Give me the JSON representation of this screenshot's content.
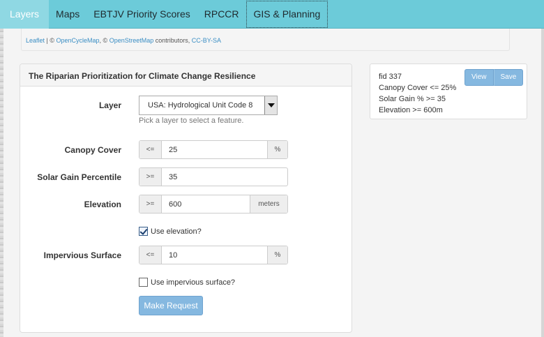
{
  "nav": {
    "items": [
      {
        "label": "Layers"
      },
      {
        "label": "Maps"
      },
      {
        "label": "EBTJV Priority Scores"
      },
      {
        "label": "RPCCR"
      },
      {
        "label": "GIS & Planning"
      }
    ]
  },
  "attribution": {
    "leaflet": "Leaflet",
    "sep1": " | © ",
    "opencyclemap": "OpenCycleMap",
    "sep2": ", © ",
    "openstreetmap": "OpenStreetMap",
    "contributors": " contributors, ",
    "license": "CC-BY-SA"
  },
  "panel": {
    "title": "The Riparian Prioritization for Climate Change Resilience",
    "layer": {
      "label": "Layer",
      "value": "USA: Hydrological Unit Code 8",
      "help": "Pick a layer to select a feature."
    },
    "canopy": {
      "label": "Canopy Cover",
      "operator": "<=",
      "value": "25",
      "unit": "%"
    },
    "solar": {
      "label": "Solar Gain Percentile",
      "operator": ">=",
      "value": "35"
    },
    "elevation": {
      "label": "Elevation",
      "operator": ">=",
      "value": "600",
      "unit": "meters"
    },
    "use_elevation": {
      "label": "Use elevation?",
      "checked": true
    },
    "impervious": {
      "label": "Impervious Surface",
      "operator": "<=",
      "value": "10",
      "unit": "%"
    },
    "use_impervious": {
      "label": "Use impervious surface?",
      "checked": false
    },
    "submit_label": "Make Request"
  },
  "summary": {
    "lines": [
      "fid 337",
      "Canopy Cover <= 25%",
      "Solar Gain % >= 35",
      "Elevation >= 600m"
    ],
    "view_label": "View",
    "save_label": "Save"
  },
  "colors": {
    "navbar": "#6ccbd9",
    "nav_active": "#8fd8e3",
    "button_primary": "#85b8e0",
    "link": "#3a8ec4"
  }
}
